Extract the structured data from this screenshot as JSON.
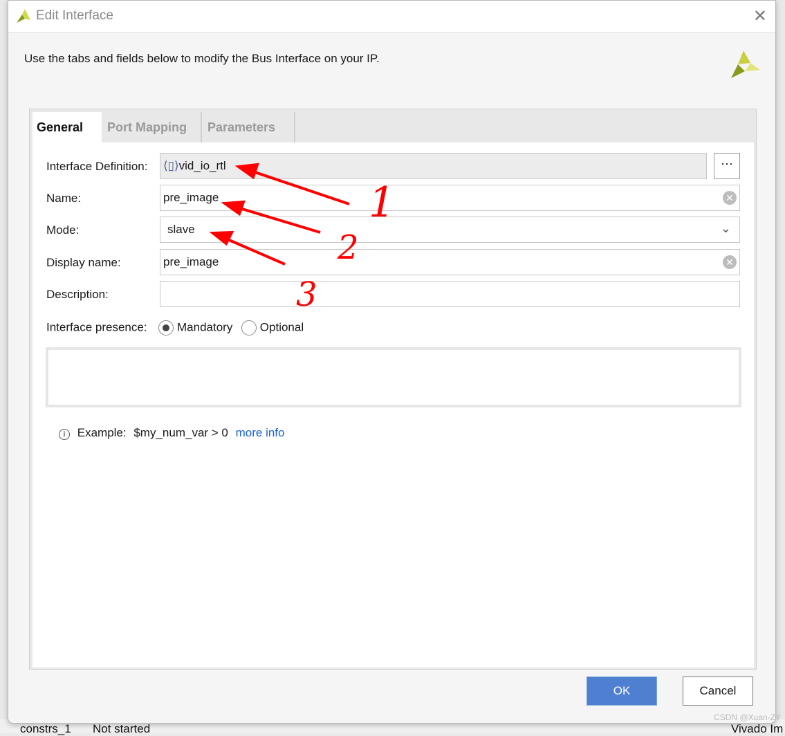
{
  "background": {
    "cells": [
      "constrs_1",
      "Not started",
      "Vivado Im"
    ],
    "watermark": "CSDN @Xuan-ZY"
  },
  "dialog": {
    "title": "Edit Interface",
    "description": "Use the tabs and fields below to modify the Bus Interface on your IP.",
    "tabs": [
      {
        "label": "General",
        "active": true
      },
      {
        "label": "Port Mapping"
      },
      {
        "label": "Parameters"
      }
    ],
    "fields": {
      "interface_definition": {
        "label": "Interface Definition:",
        "value": "vid_io_rtl"
      },
      "name": {
        "label": "Name:",
        "value": "pre_image"
      },
      "mode": {
        "label": "Mode:",
        "value": "slave"
      },
      "display_name": {
        "label": "Display name:",
        "value": "pre_image"
      },
      "description": {
        "label": "Description:",
        "value": ""
      },
      "presence": {
        "label": "Interface presence:",
        "options": [
          "Mandatory",
          "Optional"
        ],
        "selected": "Mandatory"
      }
    },
    "example": {
      "prefix": "Example:",
      "expr": "$my_num_var > 0",
      "link": "more info"
    },
    "ok": "OK",
    "cancel": "Cancel"
  },
  "annotations": {
    "color": "#ff0000",
    "numbers": [
      "1",
      "2",
      "3"
    ]
  }
}
